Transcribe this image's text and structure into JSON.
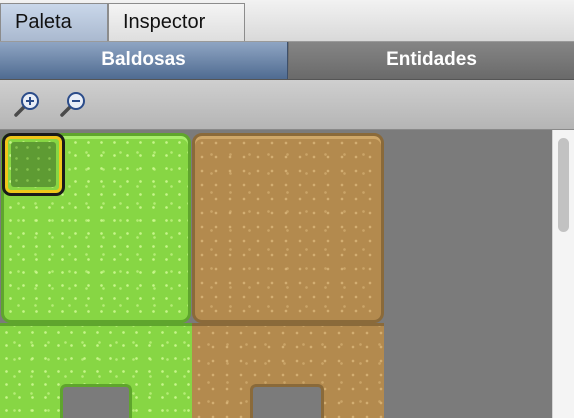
{
  "top_tabs": [
    {
      "label": "Paleta",
      "active": true
    },
    {
      "label": "Inspector",
      "active": false
    }
  ],
  "sub_tabs": [
    {
      "label": "Baldosas",
      "active": true
    },
    {
      "label": "Entidades",
      "active": false
    }
  ],
  "toolbar": {
    "zoom_in_icon": "zoom-in-icon",
    "zoom_out_icon": "zoom-out-icon"
  },
  "tileset": {
    "tiles": [
      "grass",
      "dirt"
    ],
    "selected": "grass-corner",
    "colors": {
      "grass": "#87d644",
      "dirt": "#b38a4e",
      "selection": "#f0c619"
    }
  }
}
